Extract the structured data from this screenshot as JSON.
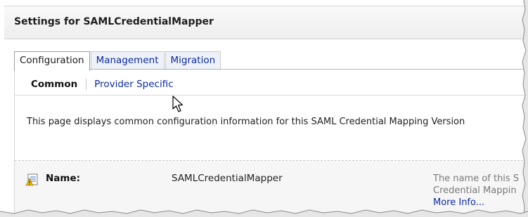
{
  "header": {
    "title": "Settings for SAMLCredentialMapper"
  },
  "tabs": [
    {
      "label": "Configuration",
      "active": true
    },
    {
      "label": "Management",
      "active": false
    },
    {
      "label": "Migration",
      "active": false
    }
  ],
  "subtabs": {
    "common": "Common",
    "provider_specific": "Provider Specific"
  },
  "description": "This page displays common configuration information for this SAML Credential Mapping Version",
  "field": {
    "icon": "field-info-icon",
    "label": "Name:",
    "value": "SAMLCredentialMapper",
    "help_line1": "The name of this S",
    "help_line2": "Credential Mappin",
    "more_info": "More Info..."
  },
  "colors": {
    "link": "#0b2a9e",
    "help_text": "#7a7a7a"
  }
}
